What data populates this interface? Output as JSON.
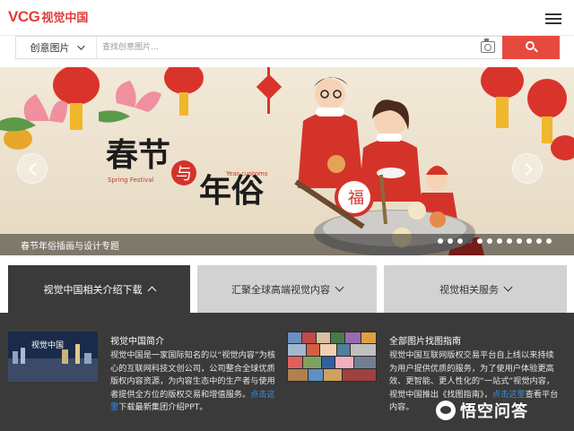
{
  "header": {
    "logo_latin": "VCG",
    "logo_cn": "视觉中国",
    "menu_icon": "hamburger-menu-icon"
  },
  "search": {
    "category_label": "创意图片",
    "placeholder": "查找创意图片...",
    "camera_icon": "camera-icon",
    "search_icon": "search-icon",
    "button_color": "#e64a3e"
  },
  "banner": {
    "title_main_1": "春节",
    "title_connector": "与",
    "title_main_2": "年俗",
    "subtitle_left": "Spring Festival",
    "subtitle_right": "Year customs",
    "fu_char": "福",
    "caption": "春节年俗插画与设计专题",
    "dots_total": 12,
    "dots_active_index": 3
  },
  "tabs": [
    {
      "label": "视觉中国相关介绍下载",
      "active": true
    },
    {
      "label": "汇聚全球高端视觉内容",
      "active": false
    },
    {
      "label": "视觉相关服务",
      "active": false
    }
  ],
  "panel": {
    "left": {
      "title": "视觉中国简介",
      "desc_before": "视觉中国是一家国际知名的以“视觉内容”为核心的互联网科技文创公司，公司整合全球优质版权内容资源，为内容生态中的生产者与使用者提供全方位的版权交易和增值服务。",
      "link_text": "点击这里",
      "desc_after": "下载最新集团介绍PPT。",
      "thumb_text": "视觉中国"
    },
    "right": {
      "title": "全部图片找图指南",
      "desc": "视觉中国互联网版权交易平台自上线以来持续为用户提供优质的服务，为了使用户体验更高效、更智能、更人性化的“一站式”视觉内容，视觉中国推出《找图指南》，",
      "link_text": "点击这里",
      "desc_after": "查看平台内容。"
    },
    "watermark": "悟空问答",
    "link_color": "#3a8ee6"
  }
}
